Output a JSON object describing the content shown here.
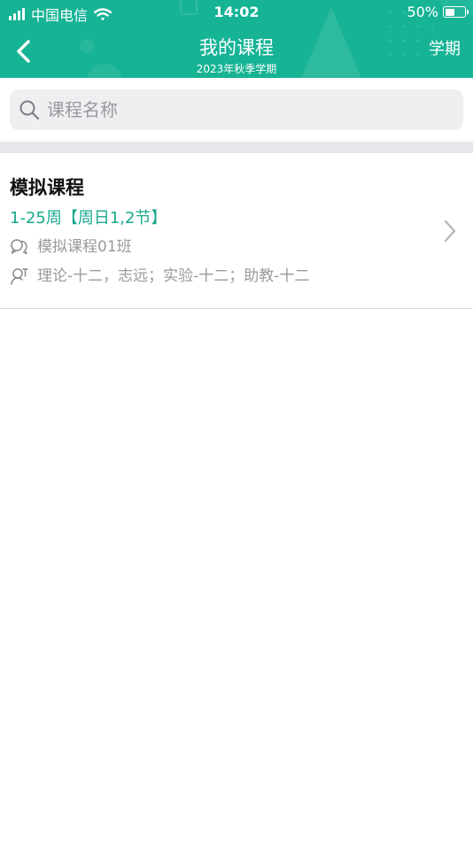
{
  "status_bar": {
    "carrier": "中国电信",
    "time": "14:02",
    "battery_text": "50%",
    "battery_level": 0.5
  },
  "nav": {
    "title": "我的课程",
    "subtitle": "2023年秋季学期",
    "term_button": "学期",
    "back_icon": "chevron-left-icon"
  },
  "search": {
    "placeholder": "课程名称",
    "value": "",
    "icon": "search-icon"
  },
  "courses": [
    {
      "name": "模拟课程",
      "schedule": "1-25周【周日1,2节】",
      "class_name": "模拟课程01班",
      "teachers": "理论-十二，志远；实验-十二；助教-十二"
    }
  ],
  "colors": {
    "header_bg": "#16b395",
    "accent_text": "#19a88b",
    "secondary_text": "#9a9a9a"
  }
}
